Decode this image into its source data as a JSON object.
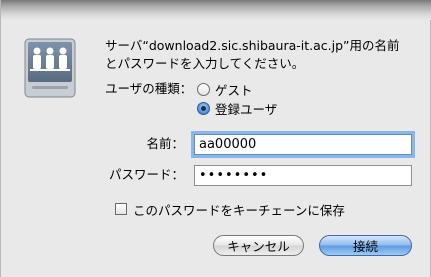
{
  "dialog": {
    "prompt_line1": "サーバ“download2.sic.shibaura-it.ac.jp”用の名前",
    "prompt_line2": "とパスワードを入力してください。",
    "user_type_label": "ユーザの種類：",
    "user_type_options": [
      {
        "label": "ゲスト",
        "selected": false
      },
      {
        "label": "登録ユーザ",
        "selected": true
      }
    ],
    "name_label": "名前：",
    "name_value": "aa00000",
    "password_label": "パスワード：",
    "password_masked": "••••••••",
    "keychain_label": "このパスワードをキーチェーンに保存",
    "keychain_checked": false,
    "cancel_label": "キャンセル",
    "connect_label": "接続"
  }
}
